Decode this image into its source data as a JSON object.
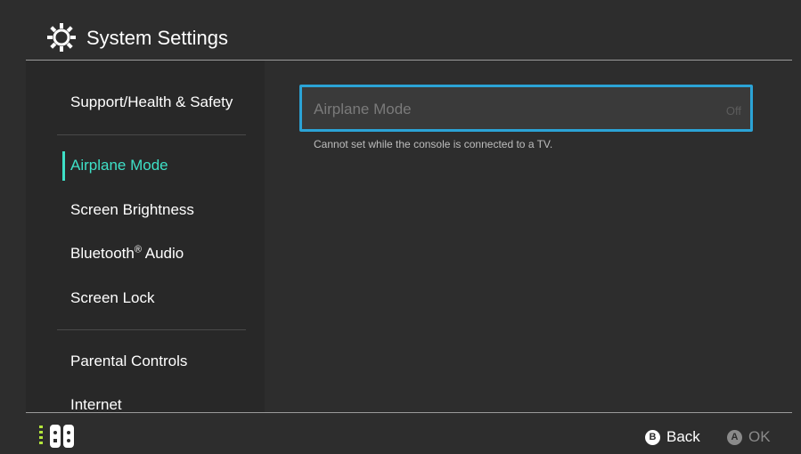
{
  "header": {
    "title": "System Settings",
    "icon": "gear-icon"
  },
  "sidebar": {
    "items": [
      {
        "label": "Support/Health & Safety"
      },
      {
        "label": "Airplane Mode",
        "active": true
      },
      {
        "label": "Screen Brightness"
      },
      {
        "label": "Bluetooth",
        "suffix": "®",
        "label_rest": " Audio"
      },
      {
        "label": "Screen Lock"
      },
      {
        "label": "Parental Controls"
      },
      {
        "label": "Internet"
      }
    ]
  },
  "main": {
    "setting": {
      "label": "Airplane Mode",
      "value": "Off",
      "disabled": true
    },
    "hint": "Cannot set while the console is connected to a TV."
  },
  "footer": {
    "back": {
      "key": "B",
      "label": "Back"
    },
    "ok": {
      "key": "A",
      "label": "OK",
      "disabled": true
    }
  },
  "colors": {
    "accent": "#3ee0c7",
    "focus_border": "#2ba3d6",
    "background": "#2d2d2d"
  }
}
